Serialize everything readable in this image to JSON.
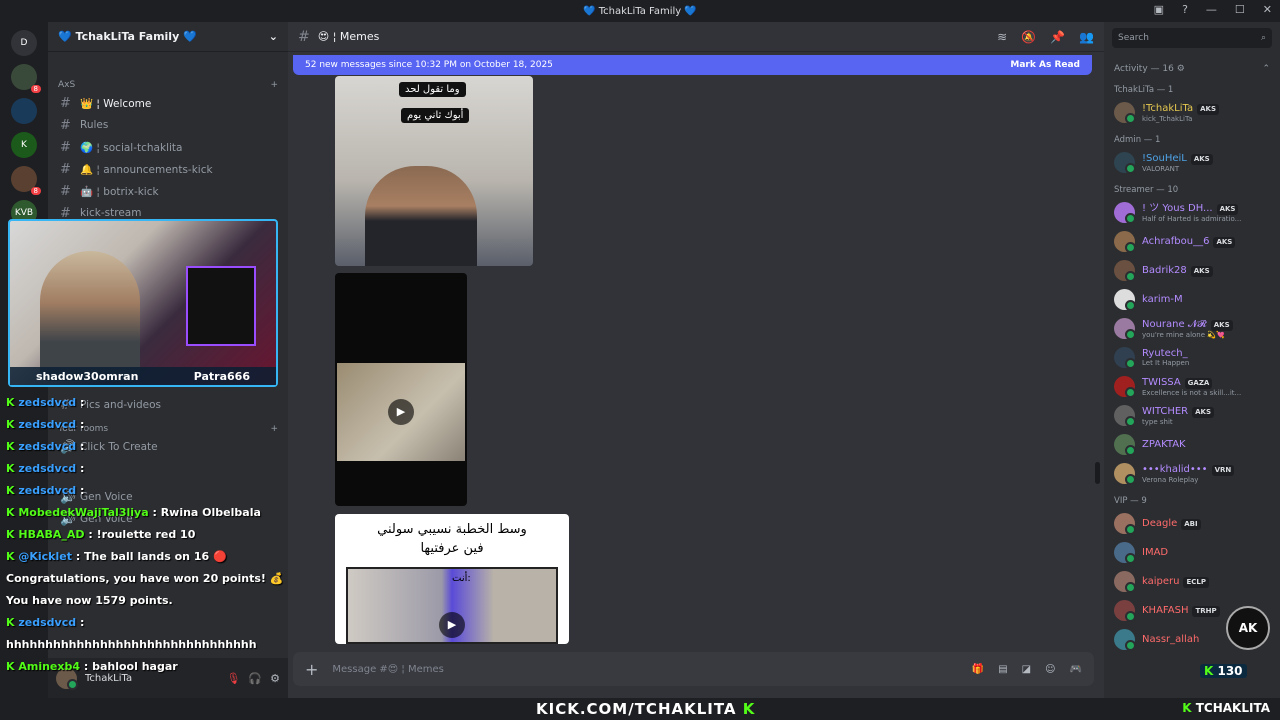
{
  "window": {
    "title": "💙 TchakLiTa Family 💙"
  },
  "servers": [
    {
      "label": "D",
      "badge": ""
    },
    {
      "label": "",
      "badge": "8"
    },
    {
      "label": "",
      "badge": ""
    },
    {
      "label": "K",
      "badge": ""
    },
    {
      "label": "",
      "badge": "8"
    },
    {
      "label": "KVB",
      "badge": ""
    }
  ],
  "sidebar": {
    "guild_name": "💙 TchakLiTa Family 💙",
    "category": "AxS",
    "channels": [
      {
        "name": "👑 ¦ Welcome",
        "active": true
      },
      {
        "name": "Rules",
        "active": false
      },
      {
        "name": "🌍 ¦ social-tchaklita",
        "active": false
      },
      {
        "name": "🔔 ¦ announcements-kick",
        "active": false
      },
      {
        "name": "🤖 ¦ botrix-kick",
        "active": false
      },
      {
        "name": "kick-stream",
        "active": false
      }
    ],
    "lower": {
      "clips": "Pics and-videos",
      "your_rooms": "Your rooms",
      "click_create": "Click To Create",
      "gen_voice_1": "Gen Voice",
      "gen_voice_2": "Gen Voice"
    },
    "user": "TchakLiTa"
  },
  "channel": {
    "name": "😍 ¦ Memes",
    "banner": "52 new messages since 10:32 PM on October 18, 2025",
    "mark_read": "Mark As Read",
    "composer_placeholder": "Message #😍 ¦ Memes",
    "meme1_line1": "وما تقول لحد",
    "meme1_line2": "أبوك ثاني يوم",
    "meme3_line1": "وسط الخطبة نسيبي سولني",
    "meme3_line2": "فين عرفتيها",
    "meme3_caption": "أنت:"
  },
  "members": {
    "search_placeholder": "Search",
    "activity": "Activity — 16 ⚙",
    "groups": [
      {
        "title": "TchakLiTa — 1",
        "items": [
          {
            "name": "!TchakLiTa",
            "tag": "AKS",
            "sub": "kick_TchakLiTa",
            "color": "#e6c84f",
            "av": "#6b5a4a"
          }
        ]
      },
      {
        "title": "Admin — 1",
        "items": [
          {
            "name": "!SouHeiL",
            "tag": "AKS",
            "sub": "VALORANT",
            "color": "#4fa3e6",
            "av": "#2e4450"
          }
        ]
      },
      {
        "title": "Streamer — 10",
        "items": [
          {
            "name": "! ツ Yous DH...",
            "tag": "AKS",
            "sub": "Half of Harted is admiratio...",
            "color": "#b48cff",
            "av": "#a06cd5"
          },
          {
            "name": "Achrafbou__6",
            "tag": "AKS",
            "sub": "",
            "color": "#b48cff",
            "av": "#8a6a4a"
          },
          {
            "name": "Badrik28",
            "tag": "AKS",
            "sub": "",
            "color": "#b48cff",
            "av": "#6a5040"
          },
          {
            "name": "karim-M",
            "tag": "",
            "sub": "",
            "color": "#b48cff",
            "av": "#dddddd"
          },
          {
            "name": "Nourane 𝓝𝓡",
            "tag": "AKS",
            "sub": "you're mine alone 💫💘",
            "color": "#b48cff",
            "av": "#9a7aa0"
          },
          {
            "name": "Ryutech_",
            "tag": "",
            "sub": "Let It Happen",
            "color": "#b48cff",
            "av": "#304050"
          },
          {
            "name": "TWISSA",
            "tag": "GAZA",
            "sub": "Excellence is not a skill...it...",
            "color": "#b48cff",
            "av": "#a02020"
          },
          {
            "name": "WITCHER",
            "tag": "AKS",
            "sub": "type shit",
            "color": "#b48cff",
            "av": "#606060"
          },
          {
            "name": "ZPAKTAK",
            "tag": "",
            "sub": "",
            "color": "#b48cff",
            "av": "#507050"
          },
          {
            "name": "•••khalid•••",
            "tag": "VRN",
            "sub": "Verona Roleplay",
            "color": "#b48cff",
            "av": "#b09060"
          }
        ]
      },
      {
        "title": "VIP — 9",
        "items": [
          {
            "name": "Deagle",
            "tag": "ABI",
            "sub": "",
            "color": "#ff6b6b",
            "av": "#9a7060"
          },
          {
            "name": "IMAD",
            "tag": "",
            "sub": "",
            "color": "#ff6b6b",
            "av": "#4a6a8a"
          },
          {
            "name": "kaiperu",
            "tag": "ECLP",
            "sub": "",
            "color": "#ff6b6b",
            "av": "#8a6a60"
          },
          {
            "name": "KHAFASH",
            "tag": "TRHP",
            "sub": "",
            "color": "#ff6b6b",
            "av": "#7a4040"
          },
          {
            "name": "Nassr_allah",
            "tag": "",
            "sub": "",
            "color": "#ff6b6b",
            "av": "#3a7a8a"
          }
        ]
      }
    ]
  },
  "stream": {
    "cam_name_left": "shadow30omran",
    "cam_name_right": "Patra666",
    "chat": [
      {
        "user": "zedsdvcd",
        "msg": ":",
        "blue": true
      },
      {
        "user": "zedsdvcd",
        "msg": ":",
        "blue": true
      },
      {
        "user": "zedsdvcd",
        "msg": ":",
        "blue": true
      },
      {
        "user": "zedsdvcd",
        "msg": ":",
        "blue": true
      },
      {
        "user": "zedsdvcd",
        "msg": ":",
        "blue": true
      },
      {
        "user": "MobedekWajiTal3liya",
        "msg": ": Rwina Olbelbala",
        "blue": false
      },
      {
        "user": "HBABA_AD",
        "msg": ": !roulette red 10",
        "blue": false
      },
      {
        "user": "@Kicklet",
        "msg": ": The ball lands on 16 🔴 Congratulations, you have won 20 points! 💰 You have now 1579 points.",
        "blue": true
      },
      {
        "user": "zedsdvcd",
        "msg": ": hhhhhhhhhhhhhhhhhhhhhhhhhhhhhhhh",
        "blue": true
      },
      {
        "user": "Aminexb4",
        "msg": ": bahlool hagar",
        "blue": false
      }
    ],
    "kick_url": "KICK.COM/TCHAKLITA",
    "viewer_count": "130",
    "brand": "TCHAKLITA",
    "ak_badge": "AK"
  }
}
